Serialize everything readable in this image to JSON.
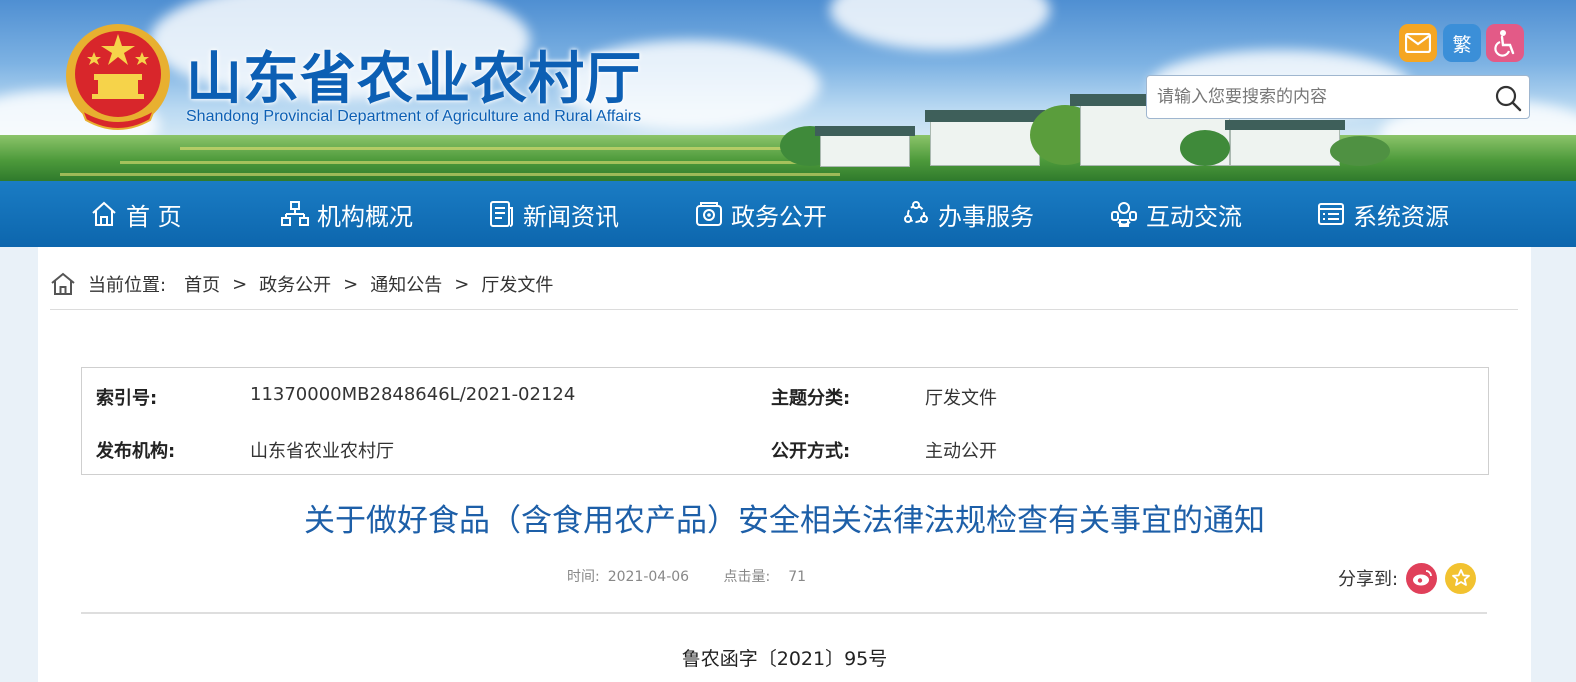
{
  "header": {
    "site_title": "山东省农业农村厅",
    "site_subtitle": "Shandong Provincial Department of Agriculture and Rural Affairs",
    "tools": {
      "traditional_label": "繁"
    },
    "search": {
      "placeholder": "请输入您要搜索的内容"
    }
  },
  "nav": {
    "items": [
      {
        "label": "首 页",
        "icon": "home-icon"
      },
      {
        "label": "机构概况",
        "icon": "org-chart-icon"
      },
      {
        "label": "新闻资讯",
        "icon": "news-icon"
      },
      {
        "label": "政务公开",
        "icon": "gov-affairs-icon"
      },
      {
        "label": "办事服务",
        "icon": "service-icon"
      },
      {
        "label": "互动交流",
        "icon": "interaction-icon"
      },
      {
        "label": "系统资源",
        "icon": "resources-icon"
      }
    ]
  },
  "breadcrumb": {
    "prefix": "当前位置:",
    "items": [
      "首页",
      "政务公开",
      "通知公告",
      "厅发文件"
    ],
    "separator": ">"
  },
  "meta": {
    "index_label": "索引号:",
    "index_value": "11370000MB2848646L/2021-02124",
    "topic_label": "主题分类:",
    "topic_value": "厅发文件",
    "publisher_label": "发布机构:",
    "publisher_value": "山东省农业农村厅",
    "disclosure_label": "公开方式:",
    "disclosure_value": "主动公开"
  },
  "article": {
    "title": "关于做好食品（含食用农产品）安全相关法律法规检查有关事宜的通知",
    "time_label": "时间:",
    "time_value": "2021-04-06",
    "views_label": "点击量:",
    "views_value": "71",
    "share_label": "分享到:",
    "doc_number": "鲁农函字〔2021〕95号"
  },
  "colors": {
    "brand_blue": "#0c5fb4",
    "nav_blue": "#1170b8",
    "title_blue": "#1d5fa8",
    "mail_orange": "#f5a623",
    "weibo_red": "#e0405a",
    "favorite_yellow": "#f2c230",
    "accessibility_pink": "#e35a87"
  }
}
